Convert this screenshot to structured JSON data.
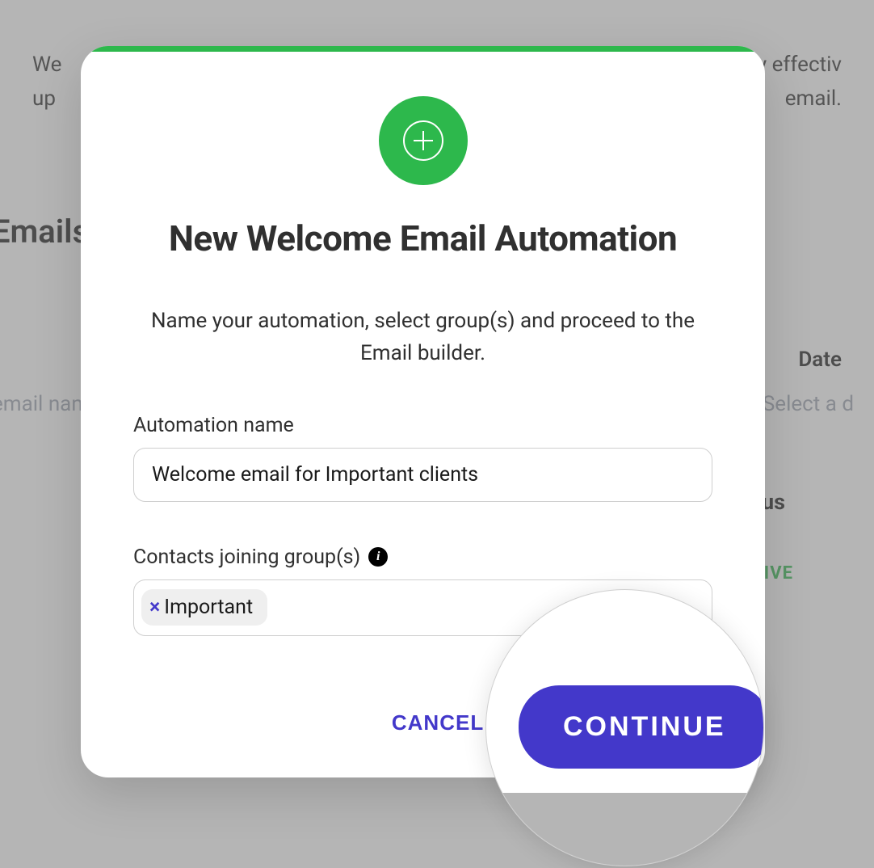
{
  "background": {
    "top_line1_left": "We",
    "top_line1_right": "ely effectiv",
    "top_line2_left": "up",
    "top_line2_right": "email.",
    "heading": "Emails",
    "col_date": "Date",
    "placeholder_left": "email nam",
    "placeholder_right": "Select a d",
    "col_status": "atus",
    "status_value": "CTIVE"
  },
  "modal": {
    "title": "New Welcome Email Automation",
    "subtitle": "Name your automation, select group(s) and proceed to the Email builder.",
    "name_label": "Automation name",
    "name_value": "Welcome email for Important clients",
    "groups_label": "Contacts joining group(s)",
    "tags": [
      {
        "label": "Important"
      }
    ],
    "cancel": "CANCEL",
    "continue": "CONTINUE"
  },
  "lens": {
    "continue": "CONTINUE"
  },
  "colors": {
    "accent_green": "#2db84c",
    "accent_blue": "#4338ca"
  }
}
